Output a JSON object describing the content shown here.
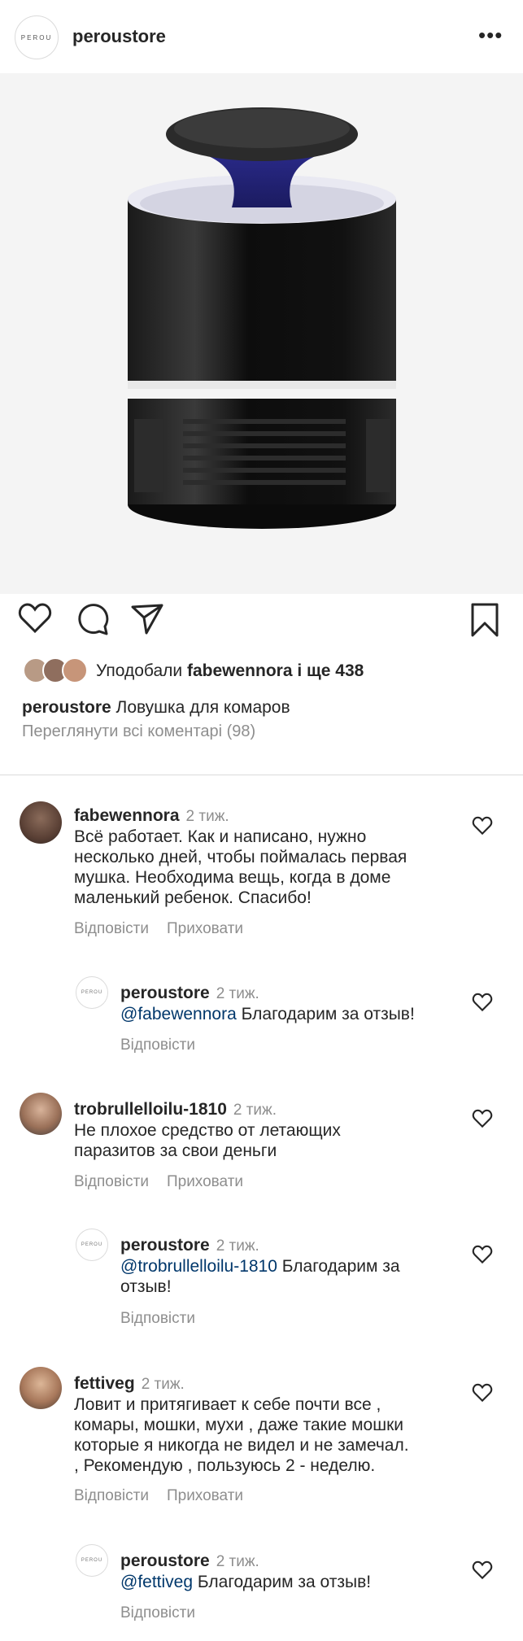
{
  "header": {
    "logo_text": "PEROU",
    "username": "peroustore",
    "more_icon": "more-horizontal-icon"
  },
  "post": {
    "image_description_icon": "product-photo",
    "likes": {
      "prefix": "Уподобали",
      "user": "fabewennora",
      "suffix": "і ще 438"
    },
    "caption": {
      "user": "peroustore",
      "text": "Ловушка для комаров"
    },
    "view_all": "Переглянути всі коментарі (98)"
  },
  "comments": [
    {
      "user": "fabewennora",
      "time": "2 тиж.",
      "lines": [
        "Всё работает. Как и написано, нужно",
        "несколько дней, чтобы поймалась первая",
        "мушка. Необходима вещь, когда в доме",
        "маленький ребенок. Спасибо!"
      ],
      "reply_label": "Відповісти",
      "hide_label": "Приховати"
    },
    {
      "user": "peroustore",
      "time": "2 тиж.",
      "mention": "@fabewennora",
      "lines": [
        " Благодарим за отзыв!"
      ],
      "reply_label": "Відповісти",
      "avatar_text": "PEROU"
    },
    {
      "user": "trobrullelloilu-1810",
      "time": "2 тиж.",
      "lines": [
        "Не плохое средство от летающих",
        "паразитов за свои деньги"
      ],
      "reply_label": "Відповісти",
      "hide_label": "Приховати"
    },
    {
      "user": "peroustore",
      "time": "2 тиж.",
      "mention": "@trobrullelloilu-1810",
      "lines": [
        " Благодарим за",
        "отзыв!"
      ],
      "reply_label": "Відповісти",
      "avatar_text": "PEROU"
    },
    {
      "user": "fettiveg",
      "time": "2 тиж.",
      "lines": [
        "Ловит и притягивает к себе почти все ,",
        "комары, мошки, мухи , даже такие мошки",
        "которые я никогда не видел и не замечал.",
        ", Рекомендую , пользуюсь 2 - неделю."
      ],
      "reply_label": "Відповісти",
      "hide_label": "Приховати"
    },
    {
      "user": "peroustore",
      "time": "2 тиж.",
      "mention": "@fettiveg",
      "lines": [
        " Благодарим за отзыв!"
      ],
      "reply_label": "Відповісти",
      "avatar_text": "PEROU"
    }
  ]
}
